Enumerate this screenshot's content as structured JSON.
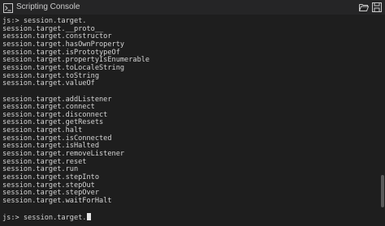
{
  "window": {
    "title": "Scripting Console",
    "icons": {
      "app": "terminal-icon",
      "open": "folder-open-icon",
      "save": "save-icon"
    },
    "colors": {
      "background": "#1e1e1e",
      "titlebar": "#252526",
      "text": "#d4d4d4"
    }
  },
  "console": {
    "first_command": "js:> session.target.",
    "group1": [
      "session.target.__proto__",
      "session.target.constructor",
      "session.target.hasOwnProperty",
      "session.target.isPrototypeOf",
      "session.target.propertyIsEnumerable",
      "session.target.toLocaleString",
      "session.target.toString",
      "session.target.valueOf"
    ],
    "group2": [
      "session.target.addListener",
      "session.target.connect",
      "session.target.disconnect",
      "session.target.getResets",
      "session.target.halt",
      "session.target.isConnected",
      "session.target.isHalted",
      "session.target.removeListener",
      "session.target.reset",
      "session.target.run",
      "session.target.stepInto",
      "session.target.stepOut",
      "session.target.stepOver",
      "session.target.waitForHalt"
    ],
    "input_line": "js:> session.target."
  }
}
